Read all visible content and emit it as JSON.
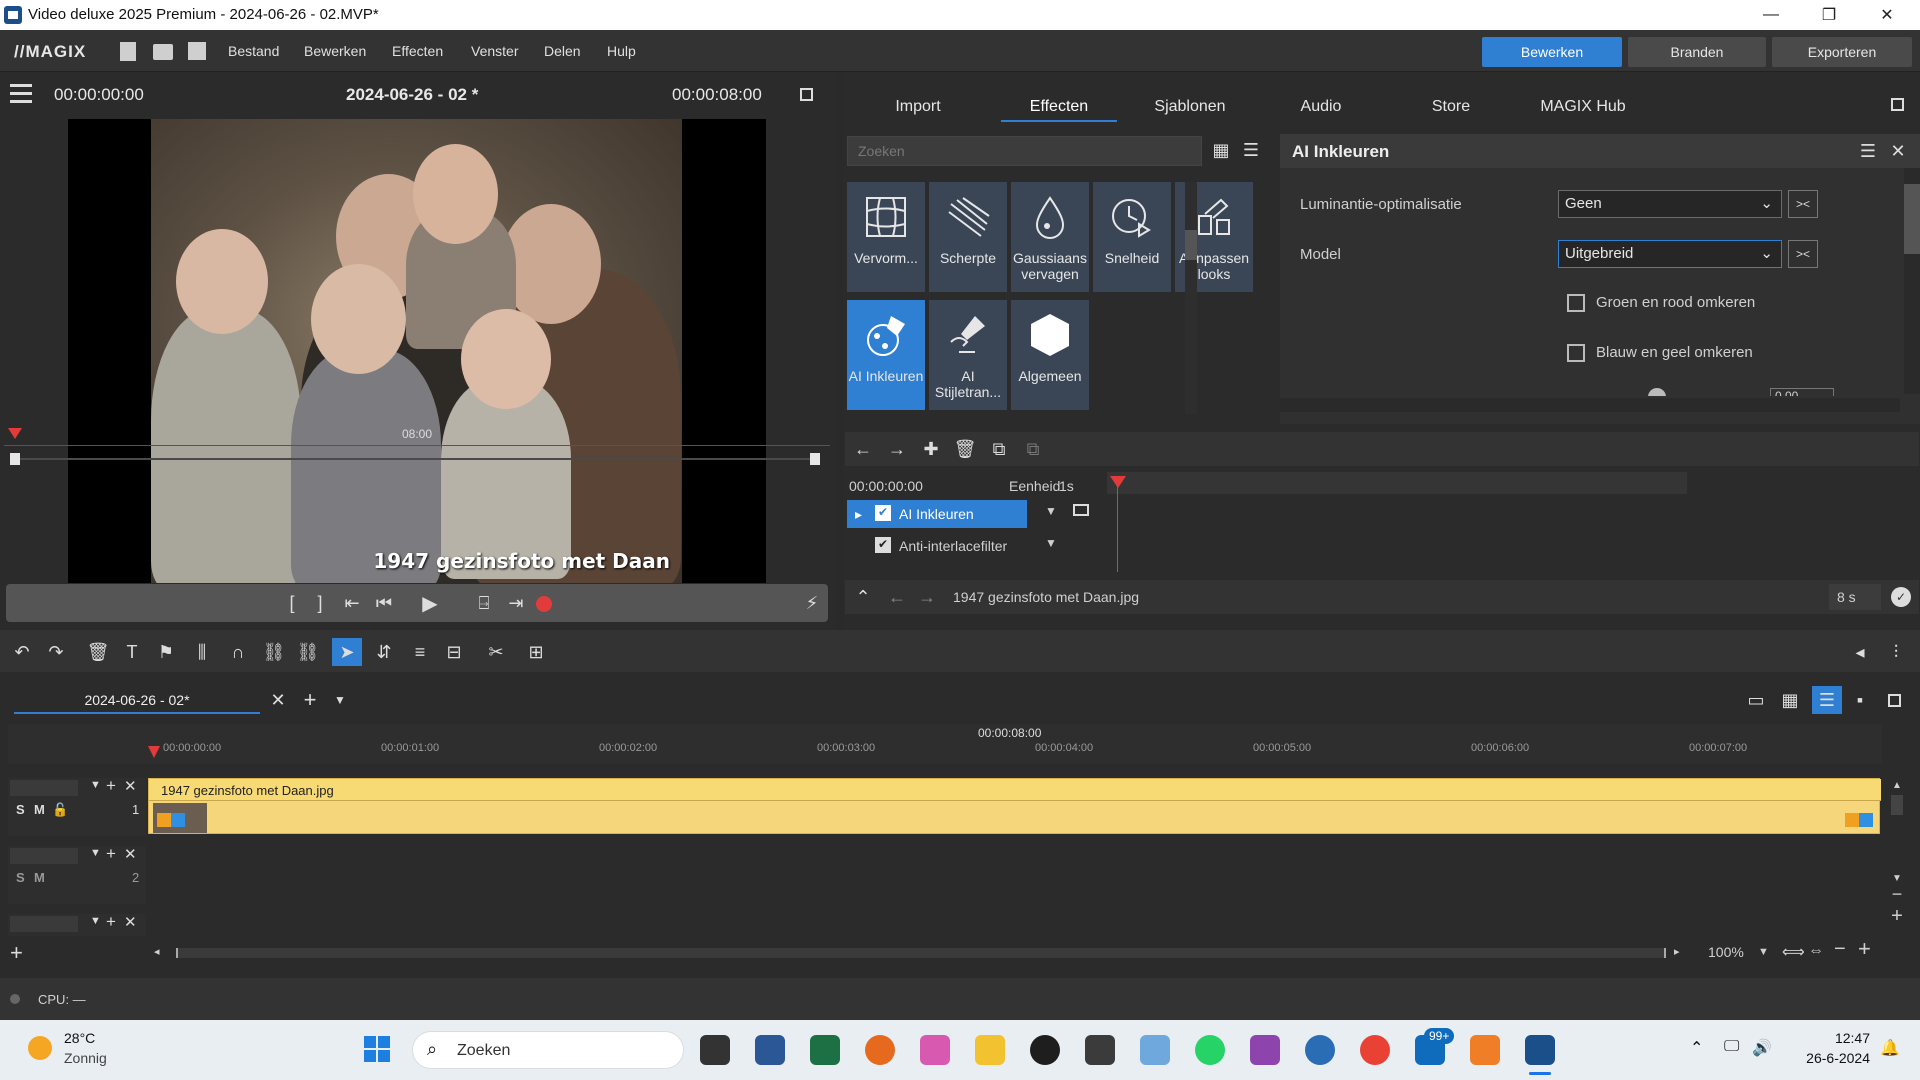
{
  "window": {
    "title": "Video deluxe 2025 Premium - 2024-06-26 - 02.MVP*",
    "min": "—",
    "restore": "❐",
    "close": "✕"
  },
  "menubar": {
    "logo": "//MAGIX",
    "items": [
      "Bestand",
      "Bewerken",
      "Effecten",
      "Venster",
      "Delen",
      "Hulp"
    ],
    "modes": [
      "Bewerken",
      "Branden",
      "Exporteren"
    ]
  },
  "preview": {
    "timecode_left": "00:00:00:00",
    "project_title": "2024-06-26 - 02 *",
    "timecode_right": "00:00:08:00",
    "caption": "1947 gezinsfoto met Daan",
    "scrub_label": "08:00"
  },
  "media": {
    "tabs": [
      "Import",
      "Effecten",
      "Sjablonen",
      "Audio",
      "Store",
      "MAGIX Hub"
    ],
    "search_placeholder": "Zoeken",
    "tiles": [
      "Vervorm...",
      "Scherpte",
      "Gaussiaans vervagen",
      "Snelheid",
      "Aanpassen looks",
      "AI Inkleuren",
      "AI Stijletran...",
      "Algemeen"
    ]
  },
  "ai_panel": {
    "title": "AI Inkleuren",
    "rows": [
      {
        "label": "Luminantie-optimalisatie",
        "value": "Geen"
      },
      {
        "label": "Model",
        "value": "Uitgebreid"
      }
    ],
    "checks": [
      "Groen en rood omkeren",
      "Blauw en geel omkeren"
    ],
    "partial_value": "0,00"
  },
  "effect_chain": {
    "timecode": "00:00:00:00",
    "unit_label": "Eenheid",
    "unit_value": "1s",
    "effects": [
      "AI Inkleuren",
      "Anti-interlacefilter"
    ],
    "file": "1947 gezinsfoto met Daan.jpg",
    "duration": "8 s"
  },
  "timeline": {
    "tab": "2024-06-26 - 02*",
    "end_time": "00:00:08:00",
    "ticks": [
      "00:00:00:00",
      "00:00:01:00",
      "00:00:02:00",
      "00:00:03:00",
      "00:00:04:00",
      "00:00:05:00",
      "00:00:06:00",
      "00:00:07:00"
    ],
    "clip_name": "1947 gezinsfoto met Daan.jpg",
    "track_labels": [
      "S",
      "M"
    ],
    "track_numbers": [
      "1",
      "2"
    ],
    "zoom": "100%"
  },
  "status": {
    "cpu": "CPU:  —"
  },
  "taskbar": {
    "temp": "28°C",
    "weather": "Zonnig",
    "search": "Zoeken",
    "time": "12:47",
    "date": "26-6-2024",
    "badge": "99+"
  }
}
